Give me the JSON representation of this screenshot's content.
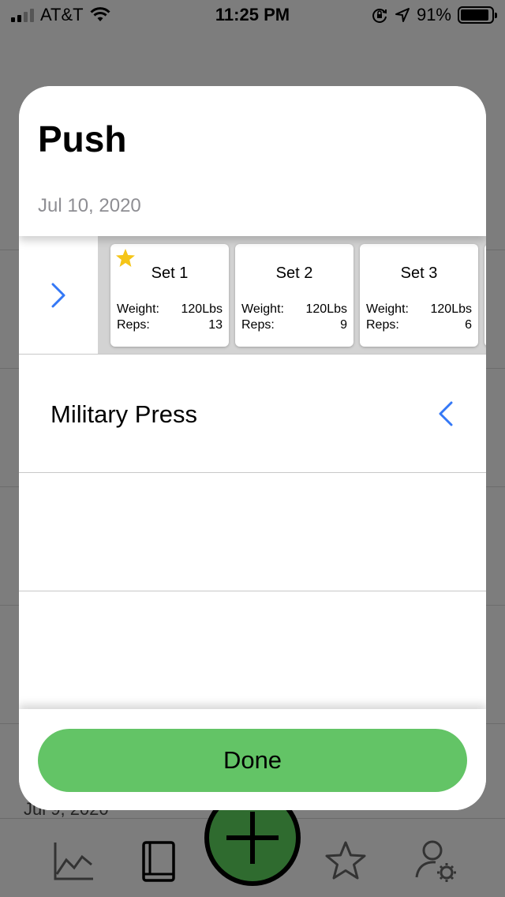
{
  "status_bar": {
    "carrier": "AT&T",
    "time": "11:25 PM",
    "battery_percent": "91%",
    "battery_level": 0.91
  },
  "background": {
    "partial_date": "Jul 9, 2020"
  },
  "modal": {
    "title": "Push",
    "date": "Jul 10, 2020",
    "sets_row": {
      "sets": [
        {
          "label": "Set 1",
          "weight_label": "Weight:",
          "weight": "120Lbs",
          "reps_label": "Reps:",
          "reps": "13",
          "starred": true
        },
        {
          "label": "Set 2",
          "weight_label": "Weight:",
          "weight": "120Lbs",
          "reps_label": "Reps:",
          "reps": "9",
          "starred": false
        },
        {
          "label": "Set 3",
          "weight_label": "Weight:",
          "weight": "120Lbs",
          "reps_label": "Reps:",
          "reps": "6",
          "starred": false
        }
      ]
    },
    "exercise": {
      "name": "Military Press"
    },
    "done_label": "Done"
  },
  "tabbar": {
    "tabs": [
      "chart-icon",
      "book-icon",
      "add-icon",
      "star-icon",
      "profile-settings-icon"
    ]
  },
  "colors": {
    "accent_blue": "#3478f6",
    "done_green": "#63c466",
    "star_yellow": "#f5c518",
    "fab_green": "#2f6b2f"
  }
}
